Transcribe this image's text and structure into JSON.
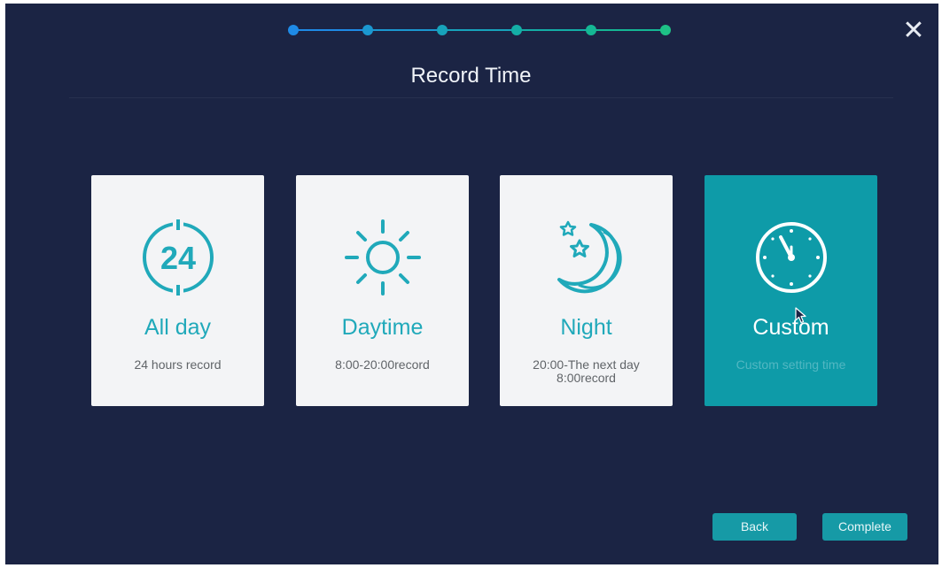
{
  "wizard": {
    "title": "Record Time",
    "steps_total": 6,
    "current_step": 6,
    "step_colors": [
      "#1e8ae6",
      "#1b97d0",
      "#17a3bb",
      "#14aea6",
      "#15b794",
      "#1ec186"
    ]
  },
  "options": [
    {
      "label": "All day",
      "description": "24 hours record",
      "icon": "24-hour-clock-icon",
      "selected": false
    },
    {
      "label": "Daytime",
      "description": "8:00-20:00record",
      "icon": "sun-icon",
      "selected": false
    },
    {
      "label": "Night",
      "description": "20:00-The next day\n8:00record",
      "icon": "moon-stars-icon",
      "selected": false
    },
    {
      "label": "Custom",
      "description": "Custom setting time",
      "icon": "clock-icon",
      "selected": true
    }
  ],
  "buttons": {
    "back": "Back",
    "complete": "Complete"
  },
  "colors": {
    "background": "#1b2444",
    "accent": "#169aa6",
    "card": "#f3f4f6",
    "card_selected": "#0e9ba8",
    "label": "#20a9ba"
  }
}
